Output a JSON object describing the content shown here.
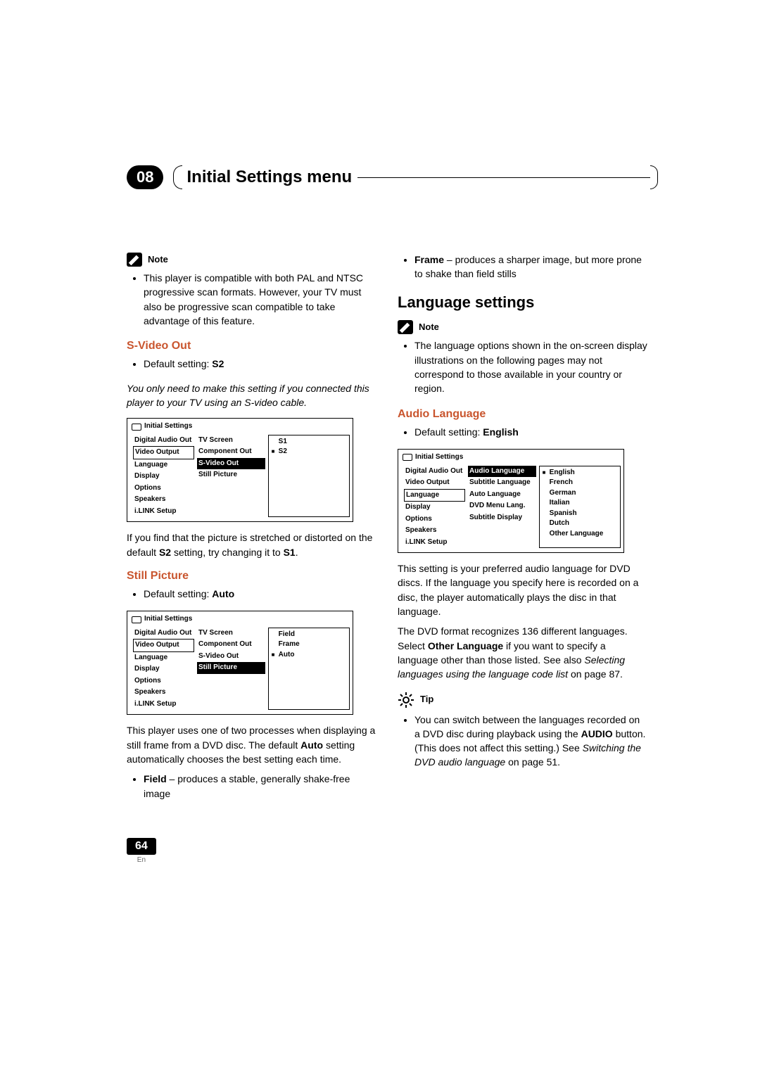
{
  "chapter": {
    "num": "08",
    "title": "Initial Settings menu"
  },
  "left": {
    "note_label": "Note",
    "note_bullet": "This player is compatible with both PAL and NTSC progressive scan formats. However, your TV must also be progressive scan compatible to take advantage of this feature.",
    "svideo": {
      "heading": "S-Video Out",
      "default_pre": "Default setting: ",
      "default_val": "S2",
      "italic": "You only need to make this setting if you connected this player to your TV using an S-video cable.",
      "after_pre": "If you find that the picture is stretched or distorted on the default ",
      "after_bold1": "S2",
      "after_mid": " setting, try changing it to ",
      "after_bold2": "S1",
      "after_post": "."
    },
    "still": {
      "heading": "Still Picture",
      "default_pre": "Default setting: ",
      "default_val": "Auto",
      "para_pre": "This player uses one of two processes when displaying a still frame from a DVD disc. The default ",
      "para_bold": "Auto",
      "para_post": " setting automatically chooses the best setting each time.",
      "field_label": "Field",
      "field_txt": " – produces a stable, generally shake-free image"
    },
    "osd1": {
      "title": "Initial Settings",
      "cats": [
        "Digital Audio Out",
        "Video Output",
        "Language",
        "Display",
        "Options",
        "Speakers",
        "i.LINK Setup"
      ],
      "cat_sel": "Video Output",
      "subs": [
        "TV Screen",
        "Component Out",
        "S-Video Out",
        "Still Picture"
      ],
      "sub_sel": "S-Video Out",
      "vals": [
        "S1",
        "S2"
      ],
      "val_sel": "S2"
    },
    "osd2": {
      "title": "Initial Settings",
      "cats": [
        "Digital Audio Out",
        "Video Output",
        "Language",
        "Display",
        "Options",
        "Speakers",
        "i.LINK Setup"
      ],
      "cat_sel": "Video Output",
      "subs": [
        "TV Screen",
        "Component Out",
        "S-Video Out",
        "Still Picture"
      ],
      "sub_sel": "Still Picture",
      "vals": [
        "Field",
        "Frame",
        "Auto"
      ],
      "val_sel": "Auto"
    }
  },
  "right": {
    "frame_label": "Frame",
    "frame_txt": " – produces a sharper image, but more prone to shake than field stills",
    "lang_heading": "Language settings",
    "note_label": "Note",
    "note_bullet": "The language options shown in the on-screen display illustrations on the following pages may not correspond to those available in your country or region.",
    "audio": {
      "heading": "Audio Language",
      "default_pre": "Default setting: ",
      "default_val": "English",
      "para1": "This setting is your preferred audio language for DVD discs. If the language you specify here is recorded on a disc, the player automatically plays the disc in that language.",
      "para2_pre": "The DVD format recognizes 136 different languages. Select ",
      "para2_bold": "Other Language",
      "para2_mid": " if you want to specify a language other than those listed. See also ",
      "para2_italic": "Selecting languages using the language code list",
      "para2_post": " on page 87."
    },
    "tip_label": "Tip",
    "tip_pre": "You can switch between the languages recorded on a DVD disc during playback using the ",
    "tip_bold": "AUDIO",
    "tip_mid": " button. (This does not affect this setting.) See ",
    "tip_italic": "Switching the DVD audio language",
    "tip_post": " on page 51.",
    "osd3": {
      "title": "Initial Settings",
      "cats": [
        "Digital Audio Out",
        "Video Output",
        "Language",
        "Display",
        "Options",
        "Speakers",
        "i.LINK Setup"
      ],
      "cat_sel": "Language",
      "subs": [
        "Audio Language",
        "Subtitle Language",
        "Auto Language",
        "DVD Menu Lang.",
        "Subtitle Display"
      ],
      "sub_sel": "Audio Language",
      "vals": [
        "English",
        "French",
        "German",
        "Italian",
        "Spanish",
        "Dutch",
        "Other Language"
      ],
      "val_sel": "English"
    }
  },
  "footer": {
    "page": "64",
    "lang": "En"
  }
}
